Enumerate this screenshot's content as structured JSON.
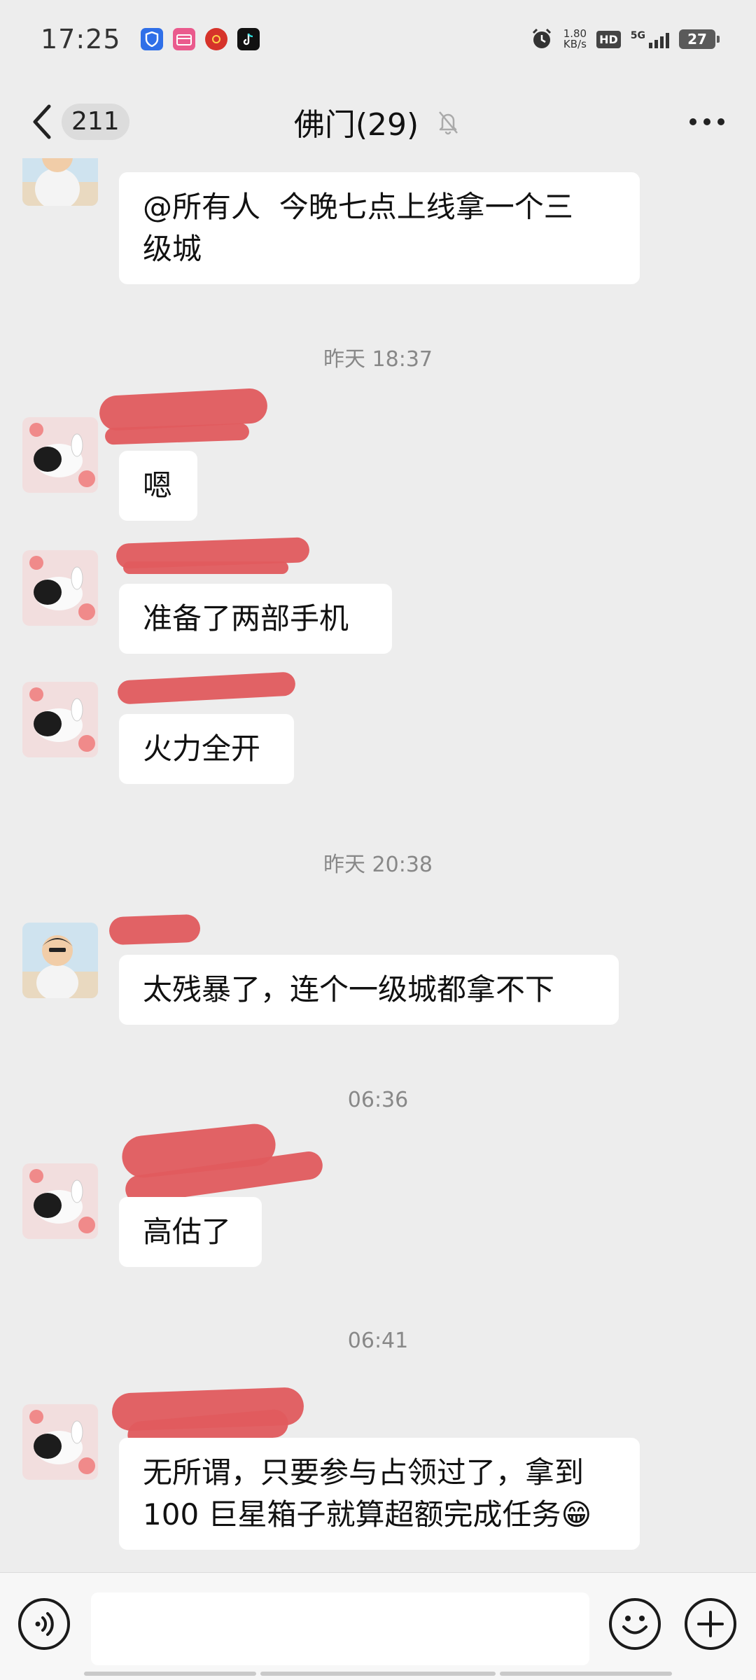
{
  "status_bar": {
    "time": "17:25",
    "net_speed_value": "1.80",
    "net_speed_unit": "KB/s",
    "hd_label": "HD",
    "network_label": "5G",
    "battery": "27"
  },
  "header": {
    "unread_count": "211",
    "title": "佛门(29)"
  },
  "messages": [
    {
      "type": "text",
      "text": "@所有人  今晚七点上线拿一个三\n级城"
    },
    {
      "type": "time",
      "text": "昨天 18:37"
    },
    {
      "type": "text",
      "text": "嗯"
    },
    {
      "type": "text",
      "text": "准备了两部手机"
    },
    {
      "type": "text",
      "text": "火力全开"
    },
    {
      "type": "time",
      "text": "昨天 20:38"
    },
    {
      "type": "text",
      "text": "太残暴了，连个一级城都拿不下"
    },
    {
      "type": "time",
      "text": "06:36"
    },
    {
      "type": "text",
      "text": "高估了"
    },
    {
      "type": "time",
      "text": "06:41"
    },
    {
      "type": "text",
      "text": "无所谓，只要参与占领过了，拿到\n100 巨星箱子就算超额完成任务😁"
    }
  ],
  "input": {
    "placeholder": ""
  },
  "icons": {
    "back": "chevron-left-icon",
    "mute": "bell-off-icon",
    "more": "more-horizontal-icon",
    "voice": "voice-icon",
    "emoji": "emoji-icon",
    "add": "plus-icon"
  },
  "colors": {
    "background": "#ededed",
    "bubble": "#ffffff",
    "redaction": "#e05b5e",
    "timestamp": "#888888"
  }
}
